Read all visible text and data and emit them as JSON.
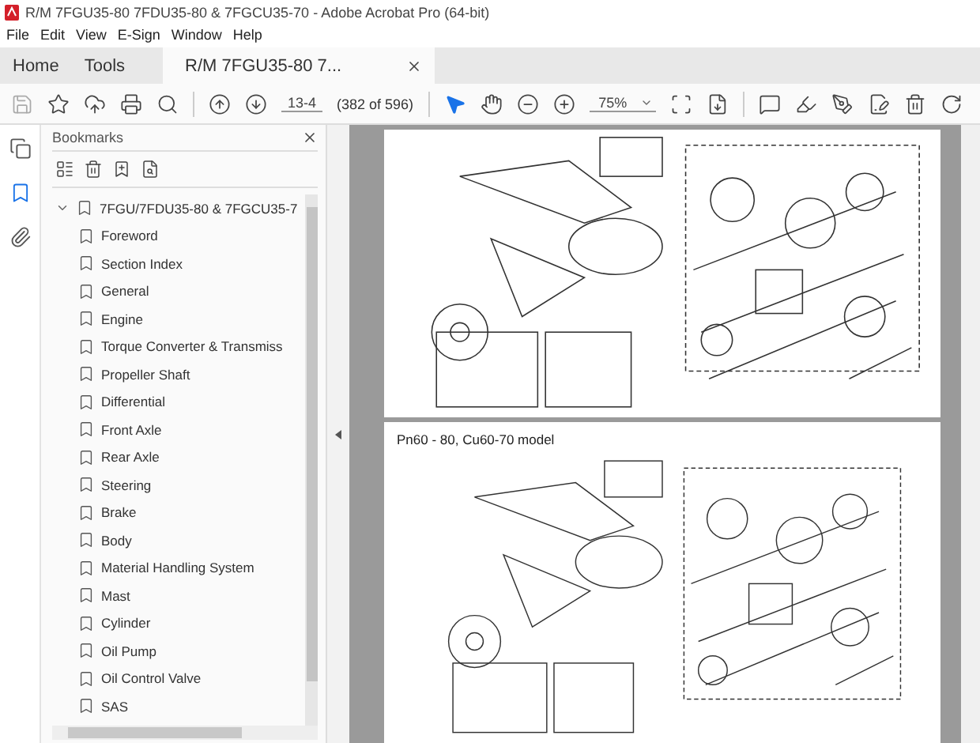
{
  "window": {
    "title": "R/M 7FGU35-80 7FDU35-80 & 7FGCU35-70 - Adobe Acrobat Pro (64-bit)"
  },
  "menu": [
    "File",
    "Edit",
    "View",
    "E-Sign",
    "Window",
    "Help"
  ],
  "tabs": [
    {
      "label": "Home",
      "selected": false
    },
    {
      "label": "Tools",
      "selected": false
    },
    {
      "label": "R/M 7FGU35-80 7...",
      "selected": true
    }
  ],
  "toolbar": {
    "page": "13-4",
    "page_count": "(382 of 596)",
    "zoom": "75%"
  },
  "sidebar": {
    "items": [
      {
        "kind": "pages",
        "selected": false
      },
      {
        "kind": "bookmarks",
        "selected": true
      },
      {
        "kind": "attachments",
        "selected": false
      }
    ]
  },
  "bookmarks": {
    "title": "Bookmarks",
    "items": [
      {
        "label": "7FGU/7FDU35-80 & 7FGCU35-7",
        "expanded": true,
        "children": [
          {
            "label": "Foreword"
          },
          {
            "label": "Section Index"
          },
          {
            "label": "General"
          },
          {
            "label": "Engine"
          },
          {
            "label": "Torque Converter & Transmiss"
          },
          {
            "label": "Propeller Shaft"
          },
          {
            "label": "Differential"
          },
          {
            "label": "Front Axle"
          },
          {
            "label": "Rear Axle"
          },
          {
            "label": "Steering"
          },
          {
            "label": "Brake"
          },
          {
            "label": "Body"
          },
          {
            "label": "Material Handling System"
          },
          {
            "label": "Mast"
          },
          {
            "label": "Cylinder"
          },
          {
            "label": "Oil Pump"
          },
          {
            "label": "Oil Control Valve"
          },
          {
            "label": "SAS"
          }
        ]
      }
    ]
  },
  "document": {
    "pages": [
      {
        "kind": "diagram"
      },
      {
        "kind": "diagram",
        "heading": "Pn60 - 80, Cu60-70 model"
      }
    ]
  }
}
